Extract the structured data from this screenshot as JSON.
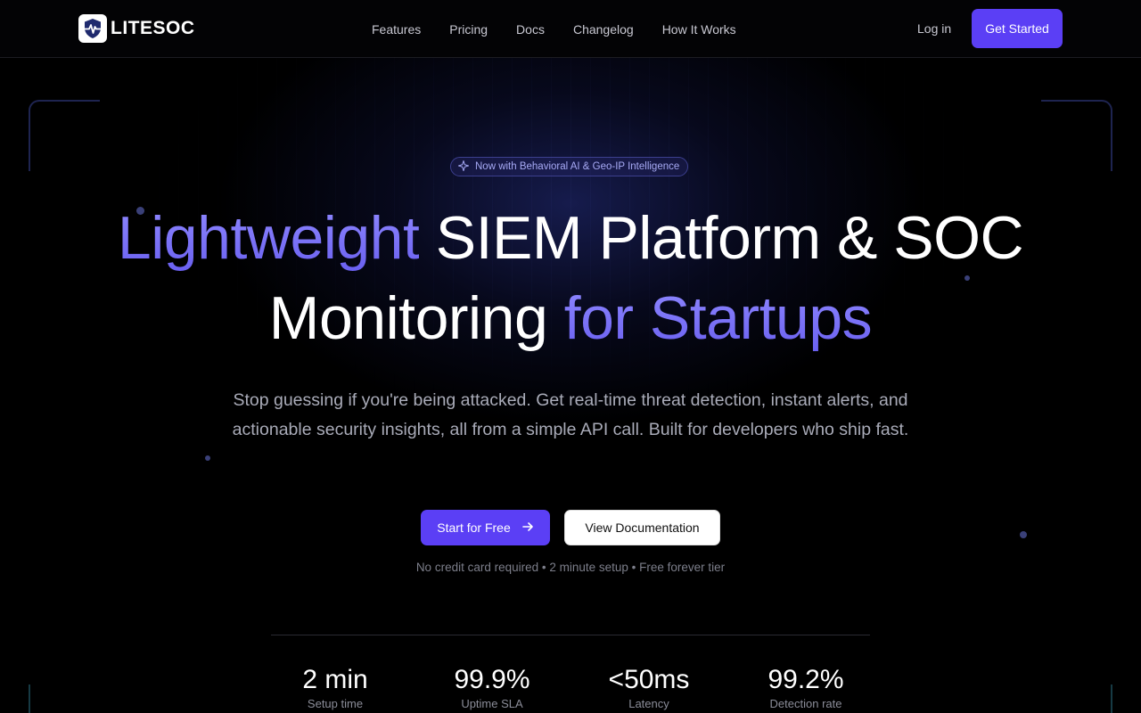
{
  "brand": {
    "name": "LITESOC",
    "logo_icon": "shield-pulse-icon"
  },
  "nav": {
    "items": [
      {
        "label": "Features"
      },
      {
        "label": "Pricing"
      },
      {
        "label": "Docs"
      },
      {
        "label": "Changelog"
      },
      {
        "label": "How It Works"
      }
    ],
    "login_label": "Log in",
    "cta_label": "Get Started"
  },
  "hero": {
    "badge": {
      "icon": "sparkle-icon",
      "text": "Now with Behavioral AI & Geo-IP Intelligence"
    },
    "headline": {
      "part1": "Lightweight",
      "part2": " SIEM Platform & SOC",
      "part3": "Monitoring ",
      "part4": "for Startups"
    },
    "subtitle": "Stop guessing if you're being attacked. Get real-time threat detection, instant alerts, and actionable security insights, all from a simple API call. Built for developers who ship fast.",
    "primary_button": "Start for Free",
    "secondary_button": "View Documentation",
    "note": "No credit card required • 2 minute setup • Free forever tier"
  },
  "stats": [
    {
      "value": "2 min",
      "label": "Setup time"
    },
    {
      "value": "99.9%",
      "label": "Uptime SLA"
    },
    {
      "value": "<50ms",
      "label": "Latency"
    },
    {
      "value": "99.2%",
      "label": "Detection rate"
    }
  ],
  "colors": {
    "accent": "#5b3ff5",
    "gradient_text": "#7a74ff",
    "background": "#000000"
  }
}
